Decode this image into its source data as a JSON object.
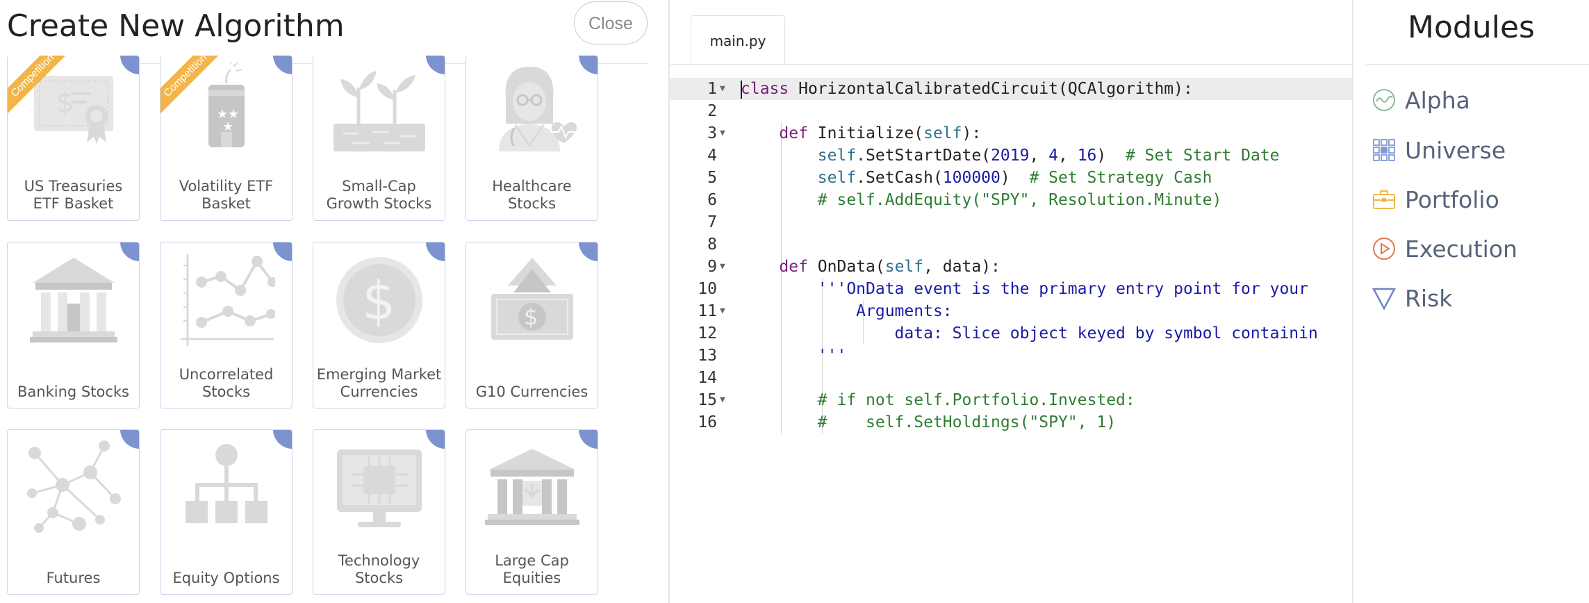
{
  "dialog": {
    "title": "Create New Algorithm",
    "close_label": "Close"
  },
  "ribbon_label": "Competition",
  "templates": [
    {
      "label": "US Treasuries ETF Basket",
      "lines": [
        "US Treasuries",
        "ETF Basket"
      ],
      "icon": "treasury-certificate-icon",
      "ribbon": true
    },
    {
      "label": "Volatility ETF Basket",
      "lines": [
        "Volatility ETF",
        "Basket"
      ],
      "icon": "dynamite-icon",
      "ribbon": true
    },
    {
      "label": "Small-Cap Growth Stocks",
      "lines": [
        "Small-Cap",
        "Growth Stocks"
      ],
      "icon": "sprout-icon",
      "ribbon": false
    },
    {
      "label": "Healthcare Stocks",
      "lines": [
        "Healthcare",
        "Stocks"
      ],
      "icon": "doctor-icon",
      "ribbon": false
    },
    {
      "label": "Banking Stocks",
      "lines": [
        "Banking Stocks"
      ],
      "icon": "bank-building-icon",
      "ribbon": false
    },
    {
      "label": "Uncorrelated Stocks",
      "lines": [
        "Uncorrelated",
        "Stocks"
      ],
      "icon": "line-chart-icon",
      "ribbon": false
    },
    {
      "label": "Emerging Market Currencies",
      "lines": [
        "Emerging Market",
        "Currencies"
      ],
      "icon": "dollar-coin-icon",
      "ribbon": false
    },
    {
      "label": "G10 Currencies",
      "lines": [
        "G10 Currencies"
      ],
      "icon": "banknote-icon",
      "ribbon": false
    },
    {
      "label": "Futures",
      "lines": [
        "Futures"
      ],
      "icon": "network-icon",
      "ribbon": false
    },
    {
      "label": "Equity Options",
      "lines": [
        "Equity Options"
      ],
      "icon": "hierarchy-icon",
      "ribbon": false
    },
    {
      "label": "Technology Stocks",
      "lines": [
        "Technology",
        "Stocks"
      ],
      "icon": "monitor-chip-icon",
      "ribbon": false
    },
    {
      "label": "Large Cap Equities",
      "lines": [
        "Large Cap",
        "Equities"
      ],
      "icon": "large-bank-icon",
      "ribbon": false
    }
  ],
  "editor": {
    "tab": "main.py",
    "lines": [
      {
        "n": "1",
        "fold": true,
        "text": "class HorizontalCalibratedCircuit(QCAlgorithm):"
      },
      {
        "n": "2",
        "fold": false,
        "text": ""
      },
      {
        "n": "3",
        "fold": true,
        "text": "    def Initialize(self):"
      },
      {
        "n": "4",
        "fold": false,
        "text": "        self.SetStartDate(2019, 4, 16)  # Set Start Date"
      },
      {
        "n": "5",
        "fold": false,
        "text": "        self.SetCash(100000)  # Set Strategy Cash"
      },
      {
        "n": "6",
        "fold": false,
        "text": "        # self.AddEquity(\"SPY\", Resolution.Minute)"
      },
      {
        "n": "7",
        "fold": false,
        "text": ""
      },
      {
        "n": "8",
        "fold": false,
        "text": ""
      },
      {
        "n": "9",
        "fold": true,
        "text": "    def OnData(self, data):"
      },
      {
        "n": "10",
        "fold": false,
        "text": "        '''OnData event is the primary entry point for your"
      },
      {
        "n": "11",
        "fold": true,
        "text": "            Arguments:"
      },
      {
        "n": "12",
        "fold": false,
        "text": "                data: Slice object keyed by symbol containin"
      },
      {
        "n": "13",
        "fold": false,
        "text": "        '''"
      },
      {
        "n": "14",
        "fold": false,
        "text": ""
      },
      {
        "n": "15",
        "fold": true,
        "text": "        # if not self.Portfolio.Invested:"
      },
      {
        "n": "16",
        "fold": false,
        "text": "        #    self.SetHoldings(\"SPY\", 1)"
      }
    ]
  },
  "modules": {
    "title": "Modules",
    "items": [
      {
        "label": "Alpha",
        "icon": "alpha-wave-icon",
        "color": "#8fb79a"
      },
      {
        "label": "Universe",
        "icon": "universe-grid-icon",
        "color": "#7f9ad6"
      },
      {
        "label": "Portfolio",
        "icon": "briefcase-icon",
        "color": "#f1b84a"
      },
      {
        "label": "Execution",
        "icon": "play-circle-icon",
        "color": "#e2774a"
      },
      {
        "label": "Risk",
        "icon": "triangle-icon",
        "color": "#6f84c4"
      }
    ]
  },
  "colors": {
    "card_corner": "#7d93cf",
    "card_border": "#ccd4ea",
    "ribbon": "#f3b54a",
    "icon_gray": "#d9d9d9"
  }
}
